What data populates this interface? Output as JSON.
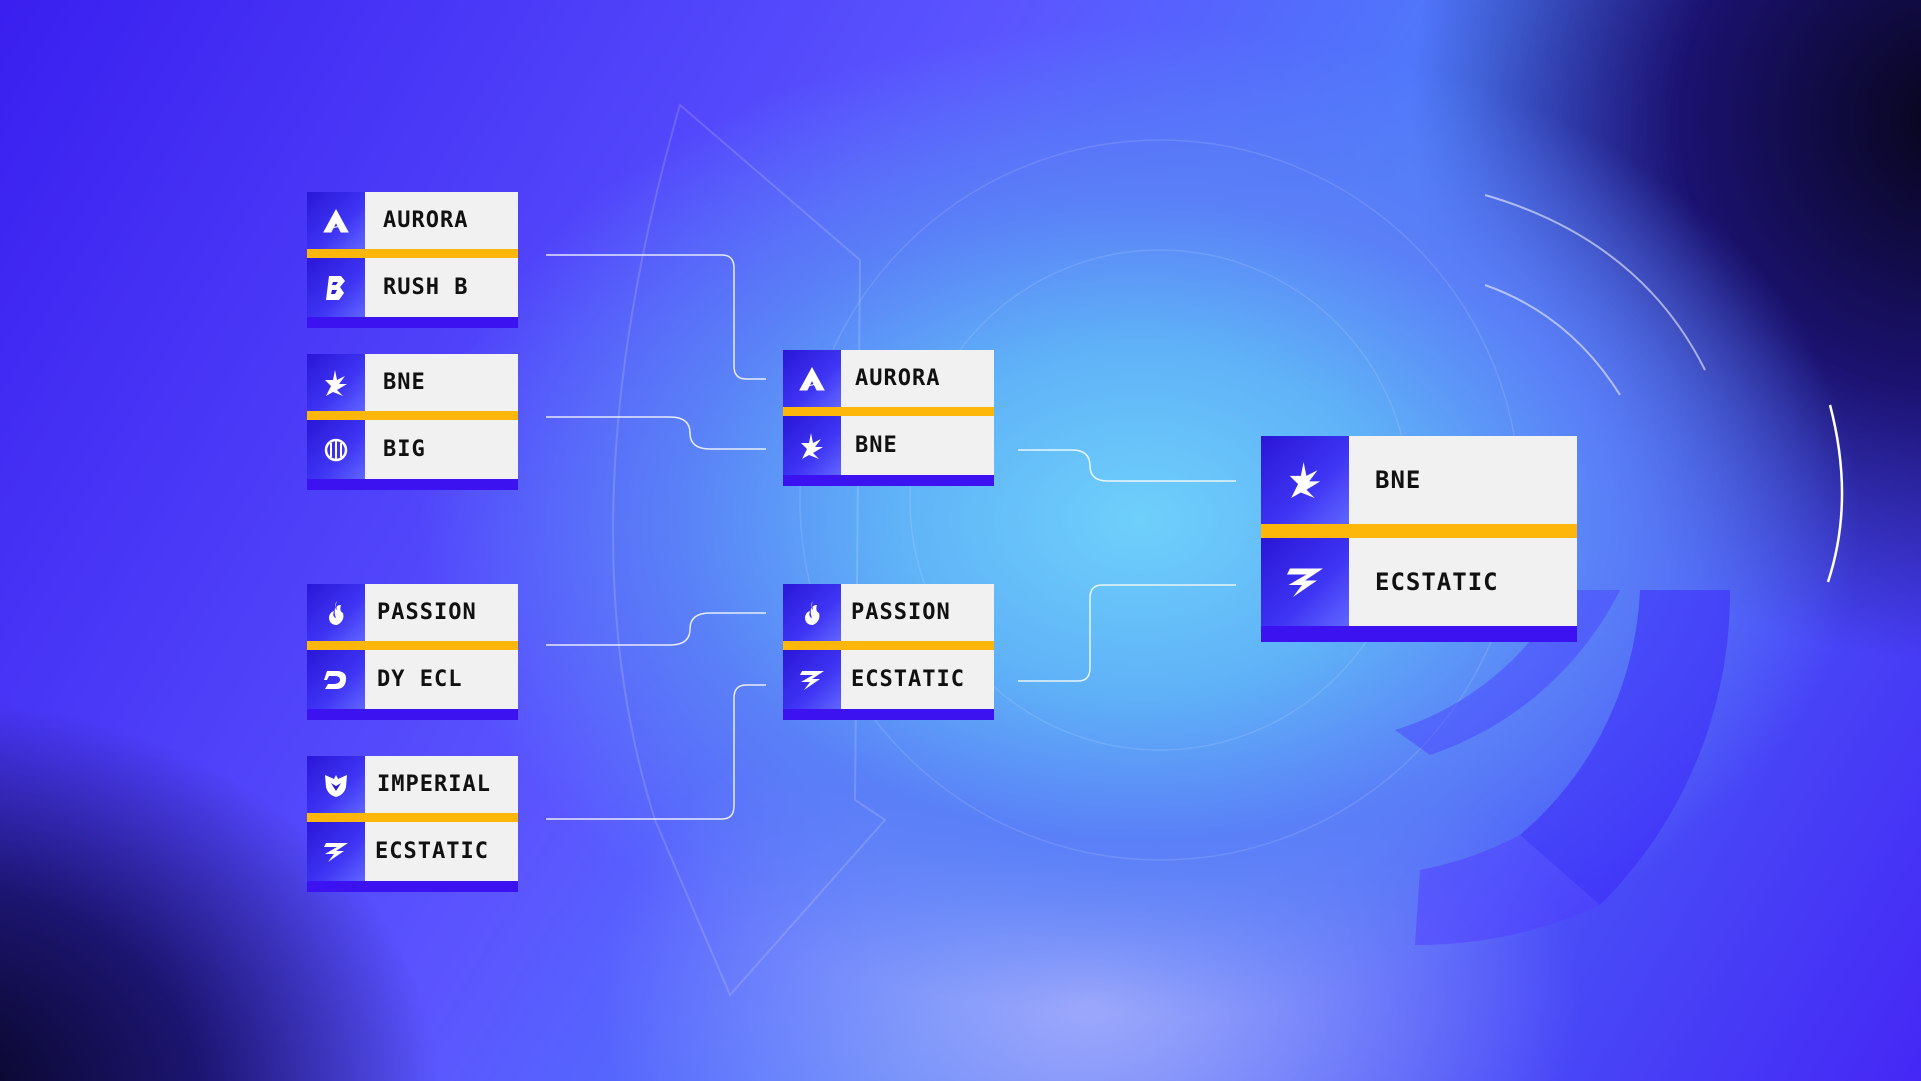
{
  "colors": {
    "accent_gold": "#fdb60a",
    "accent_blue": "#3d12f0",
    "card_bg": "#f1f1f1",
    "connector": "#ffffff"
  },
  "bracket": {
    "round1": [
      {
        "top": {
          "team": "AURORA",
          "icon": "aurora-logo-icon"
        },
        "bottom": {
          "team": "RUSH B",
          "icon": "rush-b-logo-icon"
        }
      },
      {
        "top": {
          "team": "BNE",
          "icon": "bne-logo-icon"
        },
        "bottom": {
          "team": "BIG",
          "icon": "big-logo-icon"
        }
      },
      {
        "top": {
          "team": "PASSION",
          "icon": "passion-logo-icon"
        },
        "bottom": {
          "team": "DY ECL",
          "icon": "dy-ecl-logo-icon"
        }
      },
      {
        "top": {
          "team": "IMPERIAL",
          "icon": "imperial-logo-icon"
        },
        "bottom": {
          "team": "ECSTATIC",
          "icon": "ecstatic-logo-icon"
        }
      }
    ],
    "semifinals": [
      {
        "top": {
          "team": "AURORA",
          "icon": "aurora-logo-icon"
        },
        "bottom": {
          "team": "BNE",
          "icon": "bne-logo-icon"
        }
      },
      {
        "top": {
          "team": "PASSION",
          "icon": "passion-logo-icon"
        },
        "bottom": {
          "team": "ECSTATIC",
          "icon": "ecstatic-logo-icon"
        }
      }
    ],
    "final": {
      "top": {
        "team": "BNE",
        "icon": "bne-logo-icon"
      },
      "bottom": {
        "team": "ECSTATIC",
        "icon": "ecstatic-logo-icon"
      }
    }
  }
}
